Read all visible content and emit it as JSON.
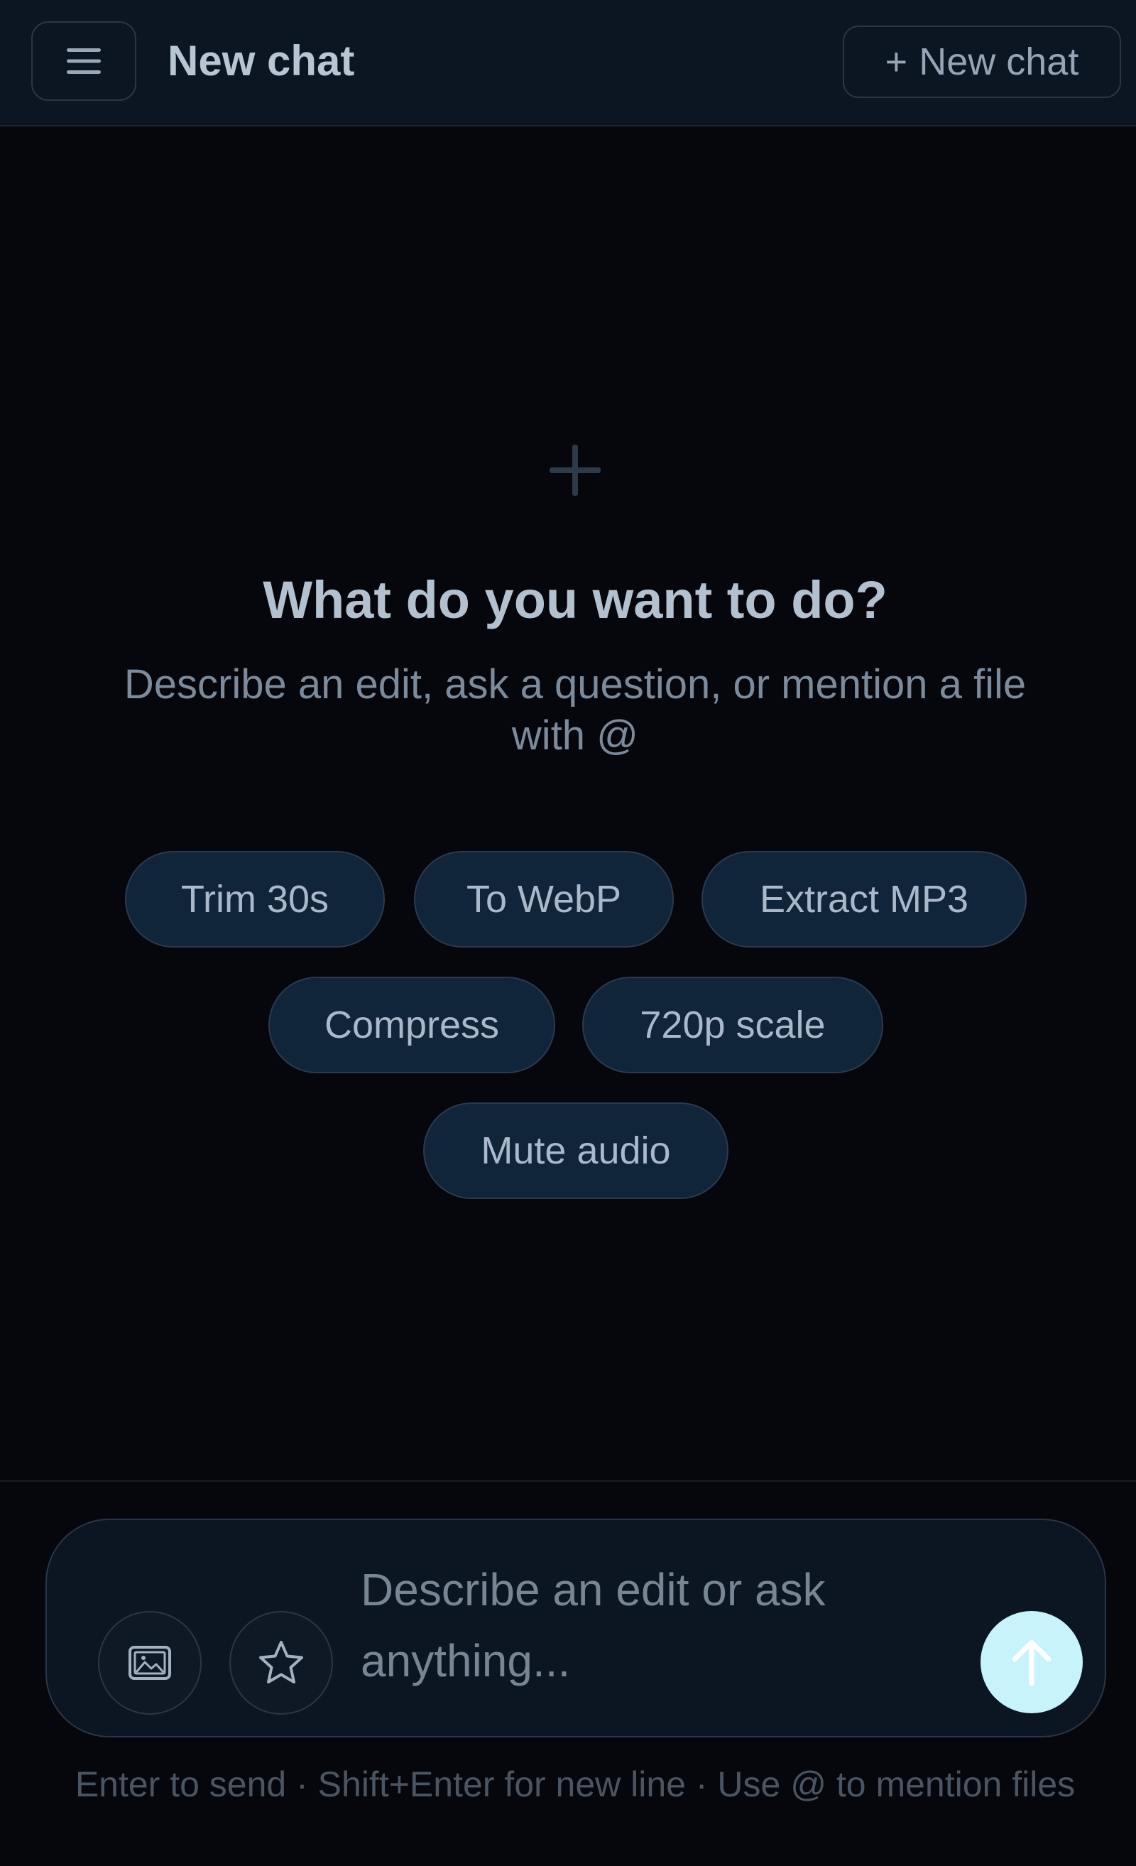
{
  "header": {
    "title": "New chat",
    "new_chat_plus": "+",
    "new_chat_label": "New chat"
  },
  "empty_state": {
    "title": "What do you want to do?",
    "subtitle": "Describe an edit, ask a question, or mention a file with @"
  },
  "chips": [
    {
      "label": "Trim 30s"
    },
    {
      "label": "To WebP"
    },
    {
      "label": "Extract MP3"
    },
    {
      "label": "Compress"
    },
    {
      "label": "720p scale"
    },
    {
      "label": "Mute audio"
    }
  ],
  "composer": {
    "placeholder": "Describe an edit or ask anything...",
    "hint": "Enter to send · Shift+Enter for new line · Use @ to mention files"
  },
  "icons": {
    "menu": "hamburger-menu-icon",
    "hero": "plus-icon",
    "attach": "image-icon",
    "favorite": "star-icon",
    "send": "arrow-up-icon"
  },
  "colors": {
    "background": "#05070c",
    "header": "#0c1522",
    "chip": "#10243a",
    "send_button": "#c7f4fb"
  }
}
